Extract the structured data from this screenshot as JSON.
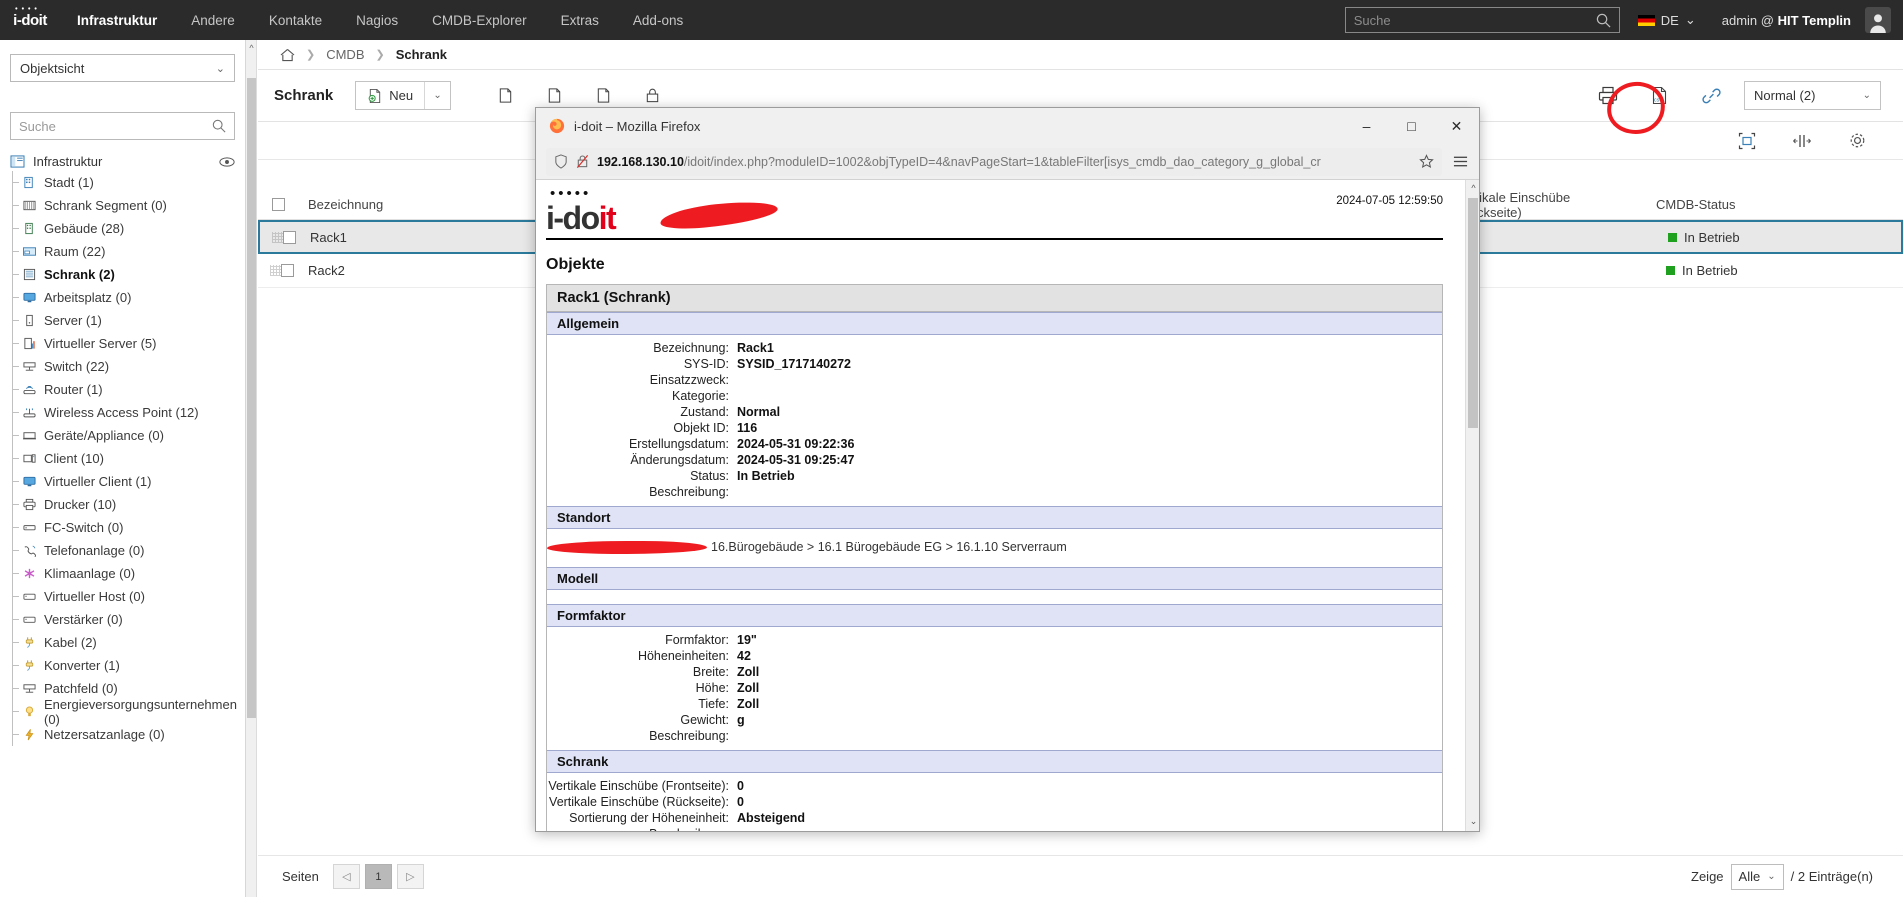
{
  "topnav": {
    "logo": "i-doit",
    "items": [
      {
        "label": "Infrastruktur",
        "active": true
      },
      {
        "label": "Andere",
        "active": false
      },
      {
        "label": "Kontakte",
        "active": false
      },
      {
        "label": "Nagios",
        "active": false
      },
      {
        "label": "CMDB-Explorer",
        "active": false
      },
      {
        "label": "Extras",
        "active": false
      },
      {
        "label": "Add-ons",
        "active": false
      }
    ],
    "search_placeholder": "Suche",
    "language": "DE",
    "user": "admin @ ",
    "tenant": "HIT Templin"
  },
  "sidebar": {
    "view_select": "Objektsicht",
    "search_placeholder": "Suche",
    "root": "Infrastruktur",
    "items": [
      {
        "label": "Stadt (1)",
        "icon": "city-icon"
      },
      {
        "label": "Schrank Segment (0)",
        "icon": "rack-segment-icon"
      },
      {
        "label": "Gebäude (28)",
        "icon": "building-icon"
      },
      {
        "label": "Raum (22)",
        "icon": "room-icon"
      },
      {
        "label": "Schrank (2)",
        "icon": "rack-icon",
        "selected": true
      },
      {
        "label": "Arbeitsplatz (0)",
        "icon": "workstation-icon"
      },
      {
        "label": "Server (1)",
        "icon": "server-icon"
      },
      {
        "label": "Virtueller Server (5)",
        "icon": "virtual-server-icon"
      },
      {
        "label": "Switch (22)",
        "icon": "switch-icon"
      },
      {
        "label": "Router (1)",
        "icon": "router-icon"
      },
      {
        "label": "Wireless Access Point (12)",
        "icon": "wifi-ap-icon"
      },
      {
        "label": "Geräte/Appliance (0)",
        "icon": "appliance-icon"
      },
      {
        "label": "Client (10)",
        "icon": "client-icon"
      },
      {
        "label": "Virtueller Client (1)",
        "icon": "virtual-client-icon"
      },
      {
        "label": "Drucker (10)",
        "icon": "printer-icon"
      },
      {
        "label": "FC-Switch (0)",
        "icon": "fc-switch-icon"
      },
      {
        "label": "Telefonanlage (0)",
        "icon": "phone-icon"
      },
      {
        "label": "Klimaanlage (0)",
        "icon": "air-conditioning-icon"
      },
      {
        "label": "Virtueller Host (0)",
        "icon": "virtual-host-icon"
      },
      {
        "label": "Verstärker (0)",
        "icon": "amplifier-icon"
      },
      {
        "label": "Kabel (2)",
        "icon": "cable-icon"
      },
      {
        "label": "Konverter (1)",
        "icon": "converter-icon"
      },
      {
        "label": "Patchfeld (0)",
        "icon": "patch-panel-icon"
      },
      {
        "label": "Energieversorgungsunternehmen (0)",
        "icon": "power-utility-icon"
      },
      {
        "label": "Netzersatzanlage (0)",
        "icon": "generator-icon"
      }
    ]
  },
  "breadcrumb": {
    "home": "home-icon",
    "level1": "CMDB",
    "level2": "Schrank"
  },
  "toolbar": {
    "title": "Schrank",
    "new_label": "Neu",
    "view_mode": "Normal (2)"
  },
  "table": {
    "headers": [
      "Bezeichnung",
      "Vertikale Einschübe (Rückseite)",
      "CMDB-Status"
    ],
    "header_label_top": "Bezeichnung",
    "rows": [
      {
        "name": "Rack1",
        "rear_slots": "",
        "status": "In Betrieb",
        "selected": true
      },
      {
        "name": "Rack2",
        "rear_slots": "",
        "status": "In Betrieb",
        "selected": false
      }
    ]
  },
  "pager": {
    "label": "Seiten",
    "prev": "◁",
    "current": "1",
    "next": "▷",
    "zeige_label": "Zeige",
    "zeige_value": "Alle",
    "entries_label": "/ 2 Einträge(n)"
  },
  "firefox": {
    "title": "i-doit – Mozilla Firefox",
    "url_host": "192.168.130.10",
    "url_path": "/idoit/index.php?moduleID=1002&objTypeID=4&navPageStart=1&tableFilter[isys_cmdb_dao_category_g_global_cr",
    "minimize": "–",
    "maximize": "□",
    "close": "✕"
  },
  "print_preview": {
    "logo": "i-doit",
    "date": "2024-07-05 12:59:50",
    "heading": "Objekte",
    "object_title": "Rack1 (Schrank)",
    "sections": [
      {
        "title": "Allgemein",
        "fields": [
          {
            "key": "Bezeichnung:",
            "value": "Rack1"
          },
          {
            "key": "SYS-ID:",
            "value": "SYSID_1717140272"
          },
          {
            "key": "Einsatzzweck:",
            "value": ""
          },
          {
            "key": "Kategorie:",
            "value": ""
          },
          {
            "key": "Zustand:",
            "value": "Normal"
          },
          {
            "key": "Objekt ID:",
            "value": "116"
          },
          {
            "key": "Erstellungsdatum:",
            "value": "2024-05-31 09:22:36"
          },
          {
            "key": "Änderungsdatum:",
            "value": "2024-05-31 09:25:47"
          },
          {
            "key": "Status:",
            "value": "In Betrieb"
          },
          {
            "key": "Beschreibung:",
            "value": ""
          }
        ]
      },
      {
        "title": "Standort",
        "location": "16.Bürogebäude > 16.1 Bürogebäude EG > 16.1.10 Serverraum"
      },
      {
        "title": "Modell",
        "fields": []
      },
      {
        "title": "Formfaktor",
        "fields": [
          {
            "key": "Formfaktor:",
            "value": "19\""
          },
          {
            "key": "Höheneinheiten:",
            "value": "42"
          },
          {
            "key": "Breite:",
            "value": "Zoll"
          },
          {
            "key": "Höhe:",
            "value": "Zoll"
          },
          {
            "key": "Tiefe:",
            "value": "Zoll"
          },
          {
            "key": "Gewicht:",
            "value": "g"
          },
          {
            "key": "Beschreibung:",
            "value": ""
          }
        ]
      },
      {
        "title": "Schrank",
        "fields": [
          {
            "key": "Vertikale Einschübe (Frontseite):",
            "value": "0"
          },
          {
            "key": "Vertikale Einschübe (Rückseite):",
            "value": "0"
          },
          {
            "key": "Sortierung der Höheneinheit:",
            "value": "Absteigend"
          },
          {
            "key": "Beschreibung:",
            "value": ""
          }
        ]
      }
    ]
  },
  "colors": {
    "nav_bg": "#2b2b2b",
    "accent_blue": "#2b7a9b",
    "status_green": "#1fa01f",
    "annotation_red": "#ee1c20",
    "section_blue": "#dfe3f5"
  }
}
